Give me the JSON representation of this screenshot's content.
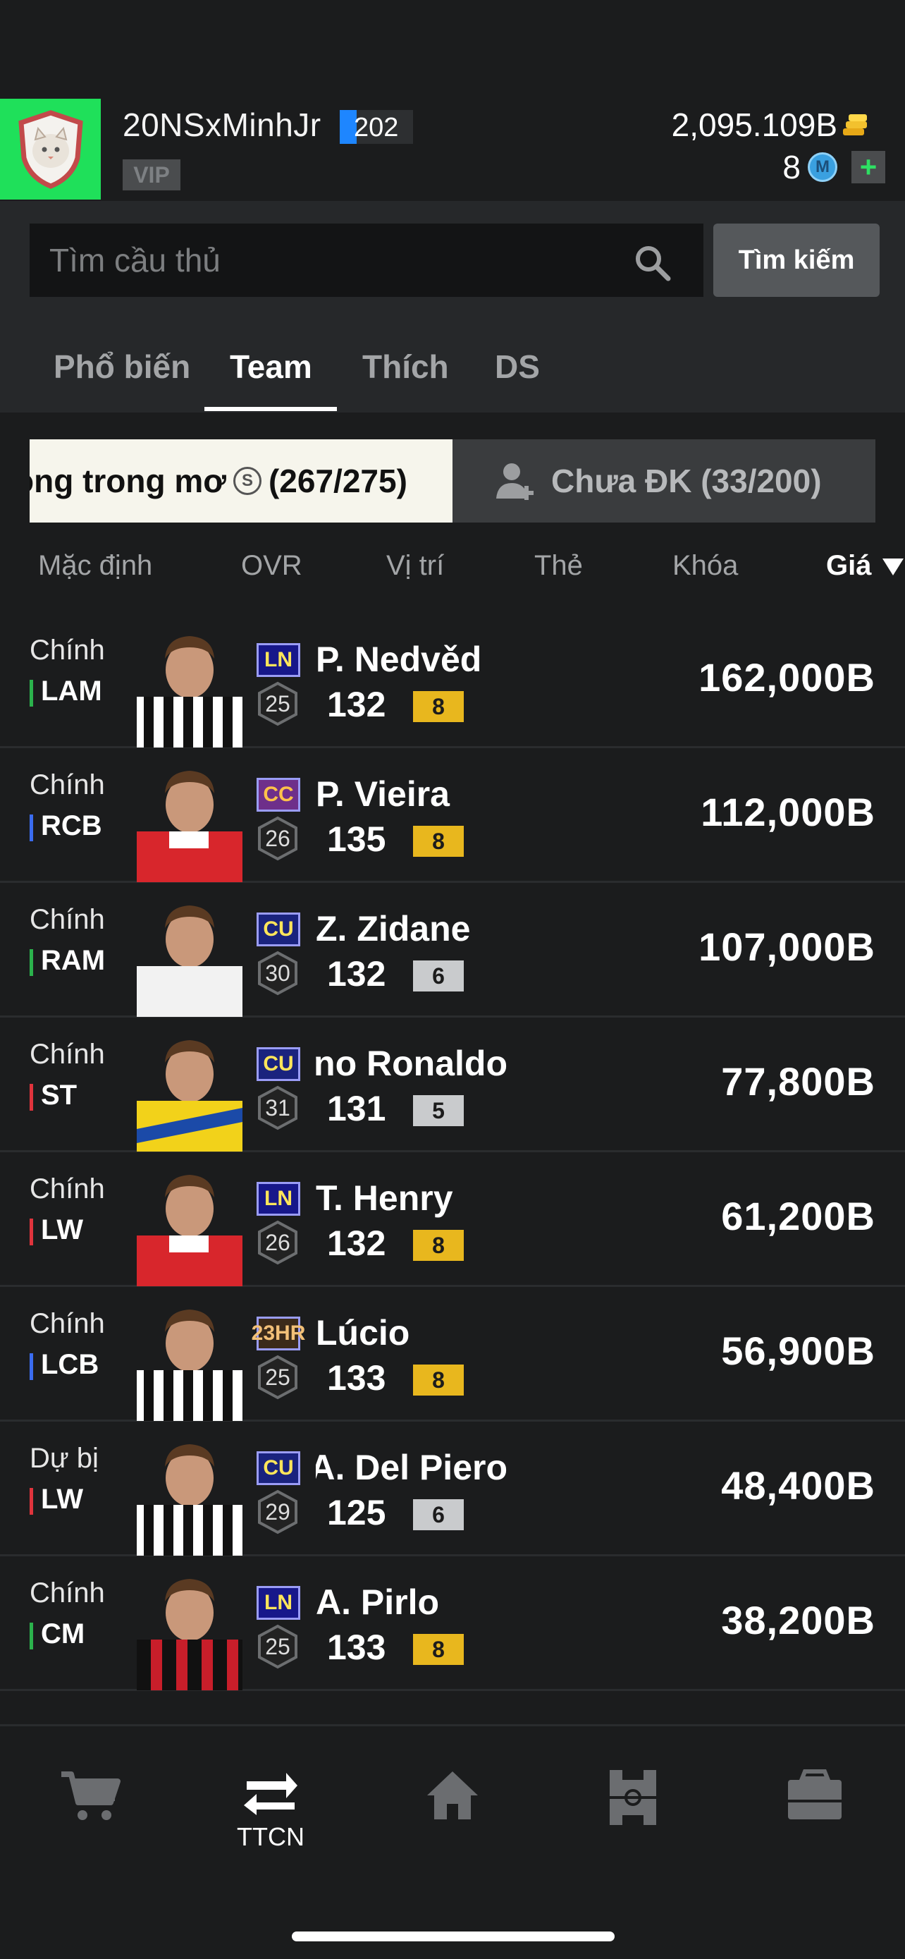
{
  "profile": {
    "username": "20NSxMinhJr",
    "level": "202",
    "vip_label": "VIP",
    "coins": "2,095.109B",
    "m_count": "8",
    "m_icon_letter": "M",
    "plus": "+"
  },
  "search": {
    "placeholder": "Tìm cầu thủ",
    "button_label": "Tìm kiếm"
  },
  "tabs": [
    {
      "label": "Phổ biến",
      "active": false
    },
    {
      "label": "Team",
      "active": true
    },
    {
      "label": "Thích",
      "active": false
    },
    {
      "label": "DS",
      "active": false
    }
  ],
  "filters": {
    "left_label_a": "óng trong mơ",
    "left_badge": "S",
    "left_count": "(267/275)",
    "right_label": "Chưa ĐK (33/200)"
  },
  "sort": {
    "items": [
      "Mặc định",
      "OVR",
      "Vị trí",
      "Thẻ",
      "Khóa",
      "Giá"
    ],
    "active": "Giá"
  },
  "players": [
    {
      "role": "Chính",
      "pos": "LAM",
      "pos_color": "#2bb24c",
      "card": "LN",
      "card_bg": "#17178a",
      "card_fg": "#ffe55a",
      "season": "25",
      "name": "P. Nedvěd",
      "ovr": "132",
      "lvl": "8",
      "lvl_type": "gold",
      "price": "162,000B",
      "kit": "juve"
    },
    {
      "role": "Chính",
      "pos": "RCB",
      "pos_color": "#3a6cf0",
      "card": "CC",
      "card_bg": "#6e2f8a",
      "card_fg": "#ffc24a",
      "season": "26",
      "name": "P. Vieira",
      "ovr": "135",
      "lvl": "8",
      "lvl_type": "gold",
      "price": "112,000B",
      "kit": "arsenal"
    },
    {
      "role": "Chính",
      "pos": "RAM",
      "pos_color": "#2bb24c",
      "card": "CU",
      "card_bg": "#1a237e",
      "card_fg": "#ffe55a",
      "season": "30",
      "name": "Z. Zidane",
      "ovr": "132",
      "lvl": "6",
      "lvl_type": "silver",
      "price": "107,000B",
      "kit": "white"
    },
    {
      "role": "Chính",
      "pos": "ST",
      "pos_color": "#e0343c",
      "card": "CU",
      "card_bg": "#1a237e",
      "card_fg": "#ffe55a",
      "season": "31",
      "name": "Cristiano Ronaldo",
      "ovr": "131",
      "lvl": "5",
      "lvl_type": "silver",
      "price": "77,800B",
      "kit": "yellow"
    },
    {
      "role": "Chính",
      "pos": "LW",
      "pos_color": "#e0343c",
      "card": "LN",
      "card_bg": "#17178a",
      "card_fg": "#ffe55a",
      "season": "26",
      "name": "T. Henry",
      "ovr": "132",
      "lvl": "8",
      "lvl_type": "gold",
      "price": "61,200B",
      "kit": "arsenal"
    },
    {
      "role": "Chính",
      "pos": "LCB",
      "pos_color": "#3a6cf0",
      "card": "23HR",
      "card_bg": "#3b2a1a",
      "card_fg": "#f2c078",
      "season": "25",
      "name": "Lúcio",
      "ovr": "133",
      "lvl": "8",
      "lvl_type": "gold",
      "price": "56,900B",
      "kit": "juve"
    },
    {
      "role": "Dự bị",
      "pos": "LW",
      "pos_color": "#e0343c",
      "card": "CU",
      "card_bg": "#1a237e",
      "card_fg": "#ffe55a",
      "season": "29",
      "name": "A. Del Piero",
      "ovr": "125",
      "lvl": "6",
      "lvl_type": "silver",
      "price": "48,400B",
      "kit": "juve"
    },
    {
      "role": "Chính",
      "pos": "CM",
      "pos_color": "#2bb24c",
      "card": "LN",
      "card_bg": "#17178a",
      "card_fg": "#ffe55a",
      "season": "25",
      "name": "A. Pirlo",
      "ovr": "133",
      "lvl": "8",
      "lvl_type": "gold",
      "price": "38,200B",
      "kit": "milan"
    }
  ],
  "bottom_nav": [
    {
      "icon": "cart-icon",
      "label": ""
    },
    {
      "icon": "transfer-icon",
      "label": "TTCN"
    },
    {
      "icon": "home-icon",
      "label": ""
    },
    {
      "icon": "formation-icon",
      "label": ""
    },
    {
      "icon": "briefcase-icon",
      "label": ""
    }
  ]
}
